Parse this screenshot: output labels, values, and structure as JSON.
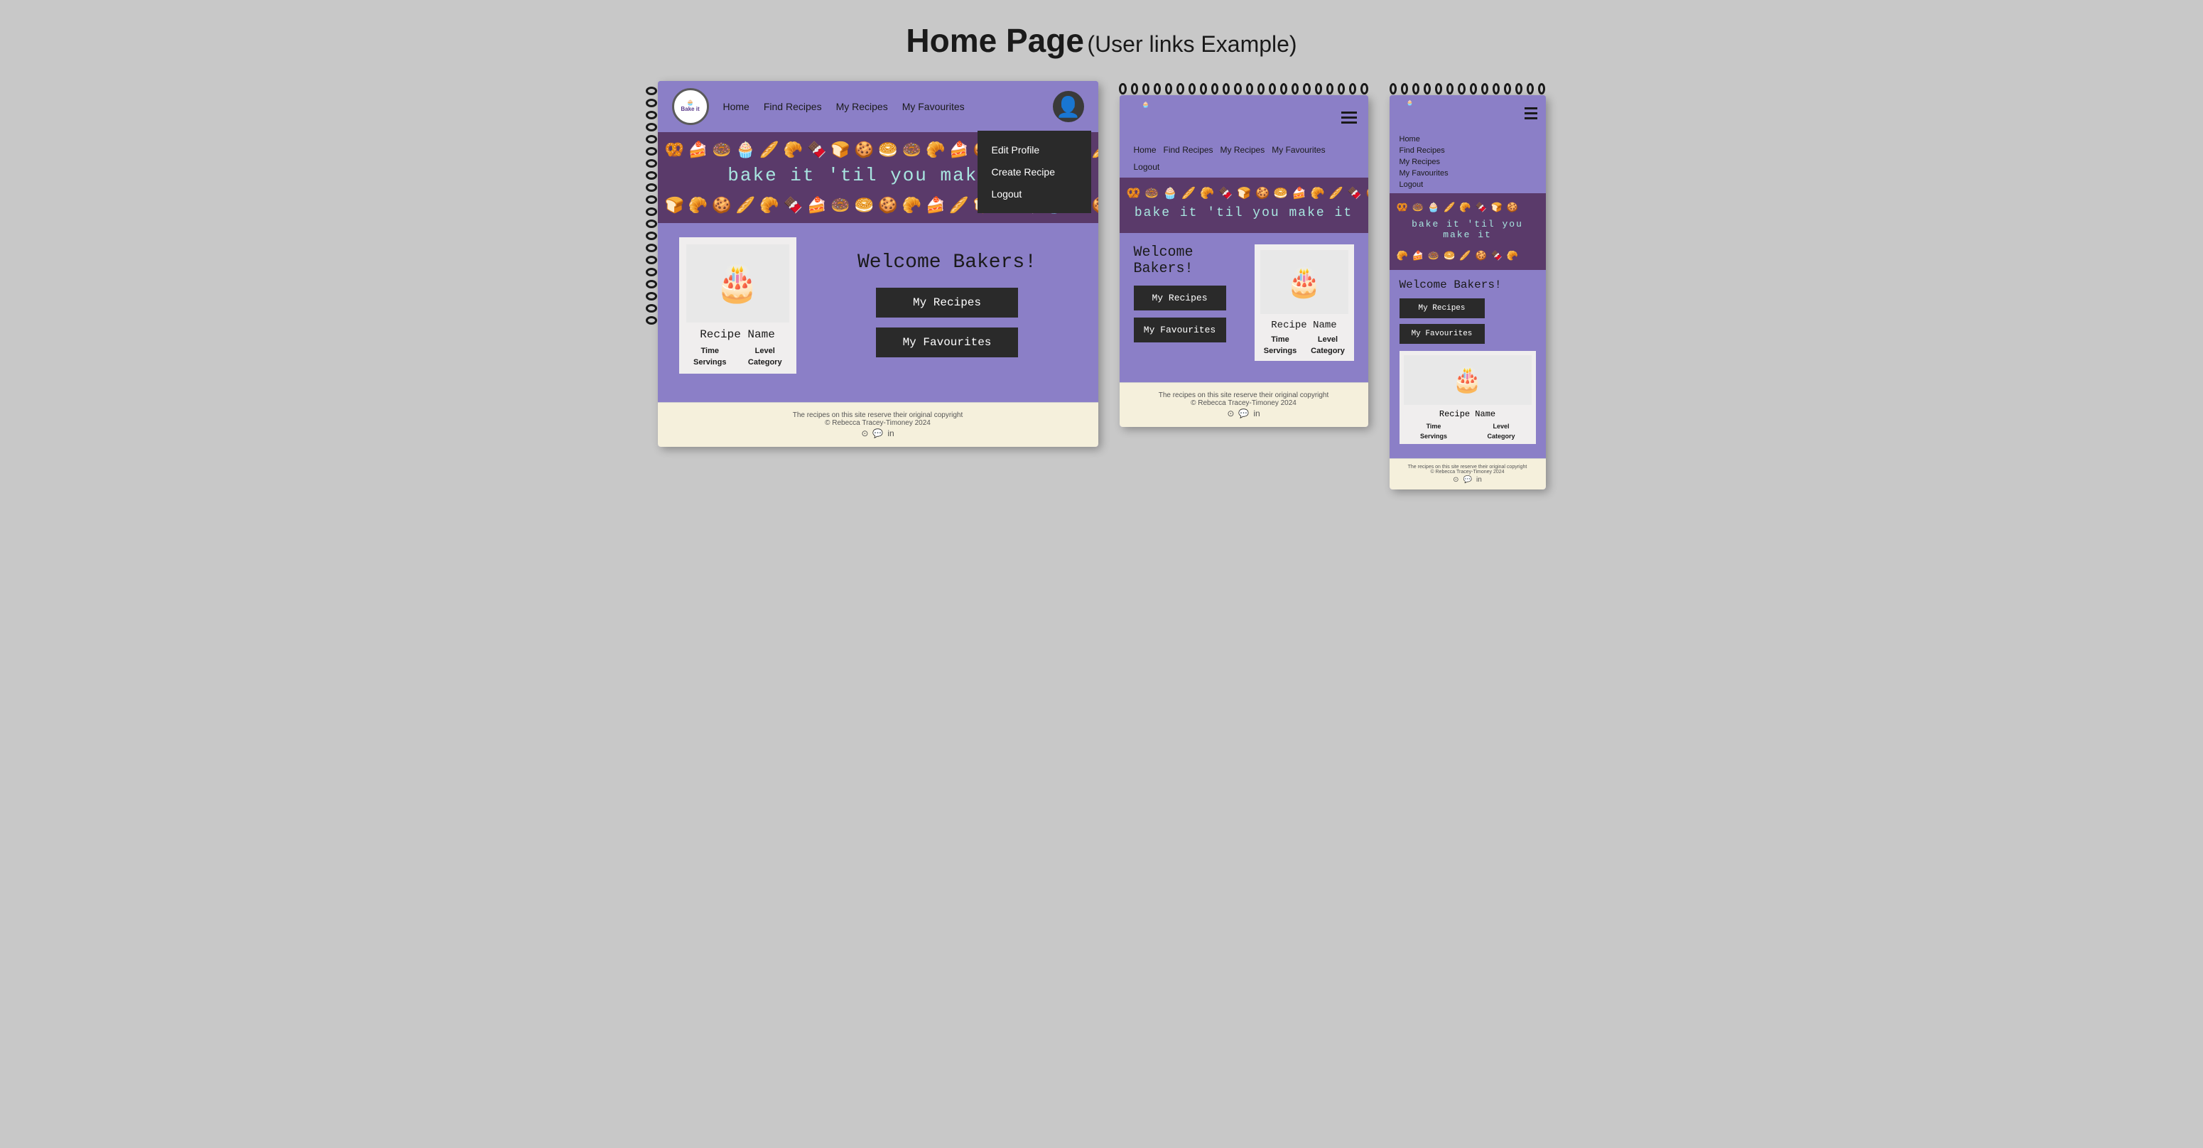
{
  "page": {
    "title": "Home Page",
    "subtitle": "(User links Example)"
  },
  "desktop": {
    "navbar": {
      "logo_text": "Bake it 'til you make it",
      "links": [
        "Home",
        "Find Recipes",
        "My Recipes",
        "My Favourites"
      ],
      "dropdown": {
        "items": [
          "Edit Profile",
          "Create Recipe",
          "Logout"
        ]
      }
    },
    "hero": {
      "text": "bake it 'til you make it",
      "food_icons": [
        "🥨",
        "🍞",
        "🍩",
        "🧁",
        "🥐",
        "🥐",
        "🍫",
        "🥖",
        "🍰",
        "🍪",
        "🥯",
        "🍩",
        "🍪",
        "🥐",
        "🍰",
        "🥖",
        "🍫",
        "🍪",
        "🥐",
        "🥖"
      ]
    },
    "welcome": {
      "text": "Welcome Bakers!",
      "btn_recipes": "My Recipes",
      "btn_favourites": "My Favourites"
    },
    "recipe_card": {
      "title": "Recipe Name",
      "meta": [
        "Time",
        "Level",
        "Servings",
        "Category"
      ]
    },
    "footer": {
      "line1": "The recipes on this site reserve their original copyright",
      "line2": "© Rebecca Tracey-Timoney 2024"
    }
  },
  "tablet": {
    "navbar": {
      "links": [
        "Home",
        "Find Recipes",
        "My Recipes",
        "My Favourites",
        "Logout"
      ]
    },
    "hero": {
      "text": "bake it 'til you make it"
    },
    "welcome": {
      "text": "Welcome Bakers!",
      "btn_recipes": "My Recipes",
      "btn_favourites": "My Favourites"
    },
    "recipe_card": {
      "title": "Recipe Name",
      "meta": [
        "Time",
        "Level",
        "Servings",
        "Category"
      ]
    },
    "footer": {
      "line1": "The recipes on this site reserve their original copyright",
      "line2": "© Rebecca Tracey-Timoney 2024"
    }
  },
  "mobile": {
    "nav_links": [
      "Home",
      "Find Recipes",
      "My Recipes",
      "My Favourites",
      "Logout"
    ],
    "hero": {
      "text": "bake it 'til you make it"
    },
    "welcome": {
      "text": "Welcome Bakers!",
      "btn_recipes": "My Recipes",
      "btn_favourites": "My Favourites"
    },
    "recipe_card": {
      "title": "Recipe Name",
      "meta": [
        "Time",
        "Level",
        "Servings",
        "Category"
      ]
    },
    "footer": {
      "line1": "The recipes on this site reserve their original copyright",
      "line2": "© Rebecca Tracey-Timoney 2024"
    }
  }
}
